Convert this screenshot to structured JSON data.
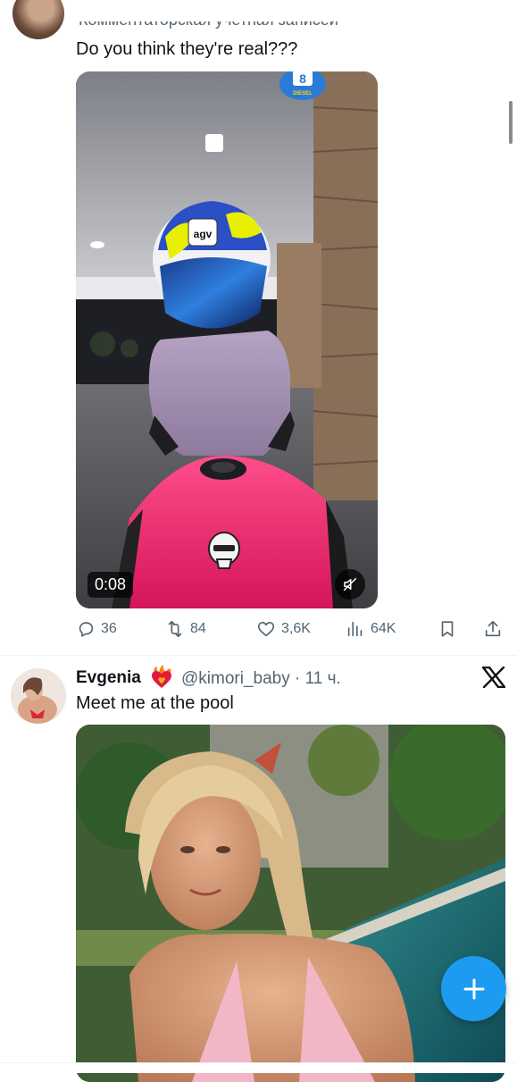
{
  "post1": {
    "context_line": "Комментаторская учетная записей",
    "text": "Do you think they're real???",
    "video": {
      "duration": "0:08",
      "badge_number": "8",
      "badge_label": "DIESEL",
      "helmet_brand": "agv"
    },
    "actions": {
      "replies": "36",
      "reposts": "84",
      "likes": "3,6K",
      "views": "64K"
    }
  },
  "post2": {
    "name": "Evgenia",
    "handle": "@kimori_baby",
    "separator": "·",
    "time": "11 ч.",
    "text": "Meet me at the pool"
  },
  "icons": {
    "reply": "reply-icon",
    "repost": "repost-icon",
    "like": "heart-icon",
    "views": "views-icon",
    "bookmark": "bookmark-icon",
    "share": "share-icon",
    "mute": "muted-speaker-icon",
    "x": "x-logo-icon",
    "compose": "plus-icon",
    "emoji": "heart-on-fire-emoji"
  },
  "colors": {
    "accent": "#1d9bf0",
    "secondary_text": "#536471",
    "primary_text": "#0f1419",
    "motorcycle": "#f0286e"
  }
}
